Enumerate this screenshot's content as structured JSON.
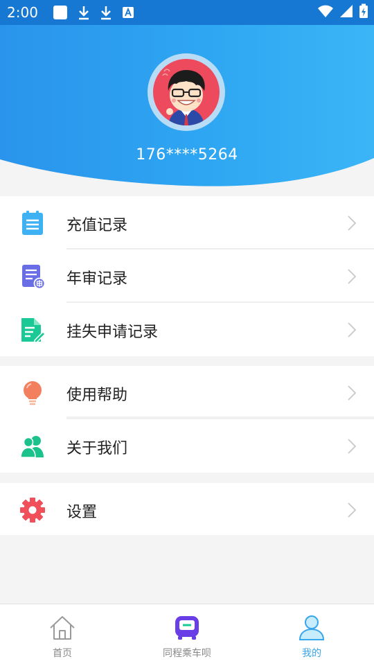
{
  "status_bar": {
    "time": "2:00",
    "icons": [
      "app-notification-icon",
      "download-icon",
      "download-icon",
      "font-icon",
      "wifi-icon",
      "cellular-signal-icon",
      "battery-charging-icon"
    ]
  },
  "profile": {
    "phone": "176****5264",
    "avatar": "cartoon-avatar"
  },
  "menu_groups": [
    {
      "items": [
        {
          "label": "充值记录",
          "icon": "list-document-icon",
          "color": "#3db1f1"
        },
        {
          "label": "年审记录",
          "icon": "annual-review-icon",
          "color": "#6a6ee6"
        },
        {
          "label": "挂失申请记录",
          "icon": "edit-document-icon",
          "color": "#1bc996"
        }
      ]
    },
    {
      "items": [
        {
          "label": "使用帮助",
          "icon": "lightbulb-icon",
          "color": "#f27f5e"
        },
        {
          "label": "关于我们",
          "icon": "users-icon",
          "color": "#1bc28b"
        }
      ]
    },
    {
      "items": [
        {
          "label": "设置",
          "icon": "gear-icon",
          "color": "#f0505a"
        }
      ]
    }
  ],
  "bottom_nav": [
    {
      "label": "首页",
      "icon": "home-icon",
      "active": false
    },
    {
      "label": "同程乘车呗",
      "icon": "bus-icon",
      "active": false
    },
    {
      "label": "我的",
      "icon": "user-icon",
      "active": true
    }
  ],
  "colors": {
    "header_blue": "#2a9ff0",
    "status_bar": "#1678d2",
    "active_tab": "#37a6ec"
  }
}
